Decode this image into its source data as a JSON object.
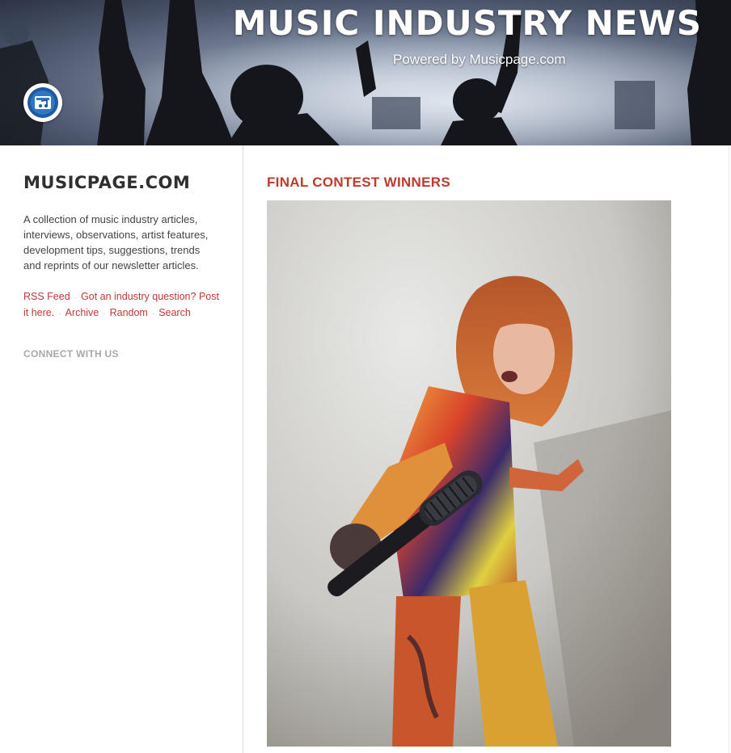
{
  "header": {
    "title": "MUSIC INDUSTRY NEWS",
    "subtitle": "Powered by Musicpage.com",
    "logo_icon": "music-note-logo-icon"
  },
  "sidebar": {
    "title": "MUSICPAGE.COM",
    "description": "A collection of music industry articles, interviews, observations, artist features, development tips, suggestions, trends and reprints of our newsletter articles.",
    "links": {
      "rss": "RSS Feed",
      "question": "Got an industry question? Post it here.",
      "archive": "Archive",
      "random": "Random",
      "search": "Search",
      "separator": "·"
    },
    "connect_heading": "CONNECT WITH US"
  },
  "post": {
    "title": "FINAL CONTEST WINNERS",
    "photo_icon": "singer-with-microphone-photo"
  },
  "colors": {
    "accent": "#c0392b",
    "sidebar_title": "#2f2f2f",
    "muted": "#a8a8a8"
  }
}
